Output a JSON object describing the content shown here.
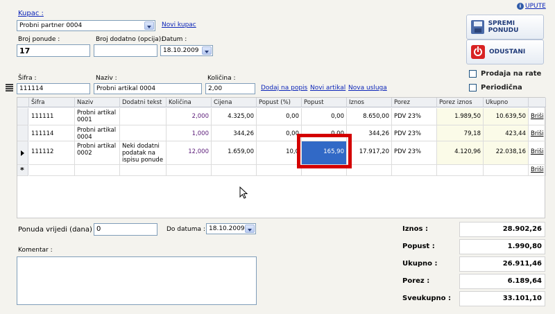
{
  "top": {
    "kupac_label": "Kupac :",
    "kupac_value": "Probni partner 0004",
    "novi_kupac": "Novi kupac",
    "broj_ponude_label": "Broj ponude :",
    "broj_ponude_value": "17",
    "broj_dodatno_label": "Broj dodatno (opcija):",
    "broj_dodatno_value": "",
    "datum_label": "Datum :",
    "datum_value": "18.10.2009",
    "upute": "UPUTE"
  },
  "actions": {
    "save_label": "SPREMI PONUDU",
    "cancel_label": "ODUSTANI",
    "prodaja_label": "Prodaja na rate",
    "periodicna_label": "Periodična"
  },
  "entry": {
    "sifra_label": "Šifra :",
    "sifra_value": "111114",
    "naziv_label": "Naziv :",
    "naziv_value": "Probni artikal 0004",
    "kolicina_label": "Količina :",
    "kolicina_value": "2,00",
    "dodaj": "Dodaj na popis",
    "novi_artikal": "Novi artikal",
    "nova_usluga": "Nova usluga"
  },
  "grid": {
    "headers": [
      "Šifra",
      "Naziv",
      "Dodatni tekst",
      "Količina",
      "Cijena",
      "Popust (%)",
      "Popust",
      "Iznos",
      "Porez",
      "Porez iznos",
      "Ukupno",
      ""
    ],
    "rows": [
      [
        "111111",
        "Probni artikal 0001",
        "",
        "2,000",
        "4.325,00",
        "0,00",
        "0,00",
        "8.650,00",
        "PDV 23%",
        "1.989,50",
        "10.639,50",
        "Briši"
      ],
      [
        "111114",
        "Probni artikal 0004",
        "",
        "1,000",
        "344,26",
        "0,00",
        "0,00",
        "344,26",
        "PDV 23%",
        "79,18",
        "423,44",
        "Briši"
      ],
      [
        "111112",
        "Probni artikal 0002",
        "Neki dodatni podatak na ispisu ponude",
        "12,000",
        "1.659,00",
        "10,0",
        "165,90",
        "17.917,20",
        "PDV 23%",
        "4.120,96",
        "22.038,16",
        "Briši"
      ],
      [
        "",
        "",
        "",
        "",
        "",
        "",
        "",
        "",
        "",
        "",
        "",
        "Briši"
      ]
    ],
    "new_row_marker": "*"
  },
  "bottom": {
    "vrijedi_label": "Ponuda vrijedi (dana) :",
    "vrijedi_value": "0",
    "do_datuma_label": "Do datuma :",
    "do_datuma_value": "18.10.2009",
    "komentar_label": "Komentar :",
    "komentar_value": ""
  },
  "totals": {
    "iznos_label": "Iznos :",
    "iznos": "28.902,26",
    "popust_label": "Popust :",
    "popust": "1.990,80",
    "ukupno_label": "Ukupno :",
    "ukupno": "26.911,46",
    "porez_label": "Porez :",
    "porez": "6.189,64",
    "sveukupno_label": "Sveukupno :",
    "sveukupno": "33.101,10"
  },
  "colors": {
    "link": "#0b24b8",
    "selected_cell": "#3169c6",
    "highlight_box": "#d40000",
    "qty_text": "#5a1a78"
  }
}
